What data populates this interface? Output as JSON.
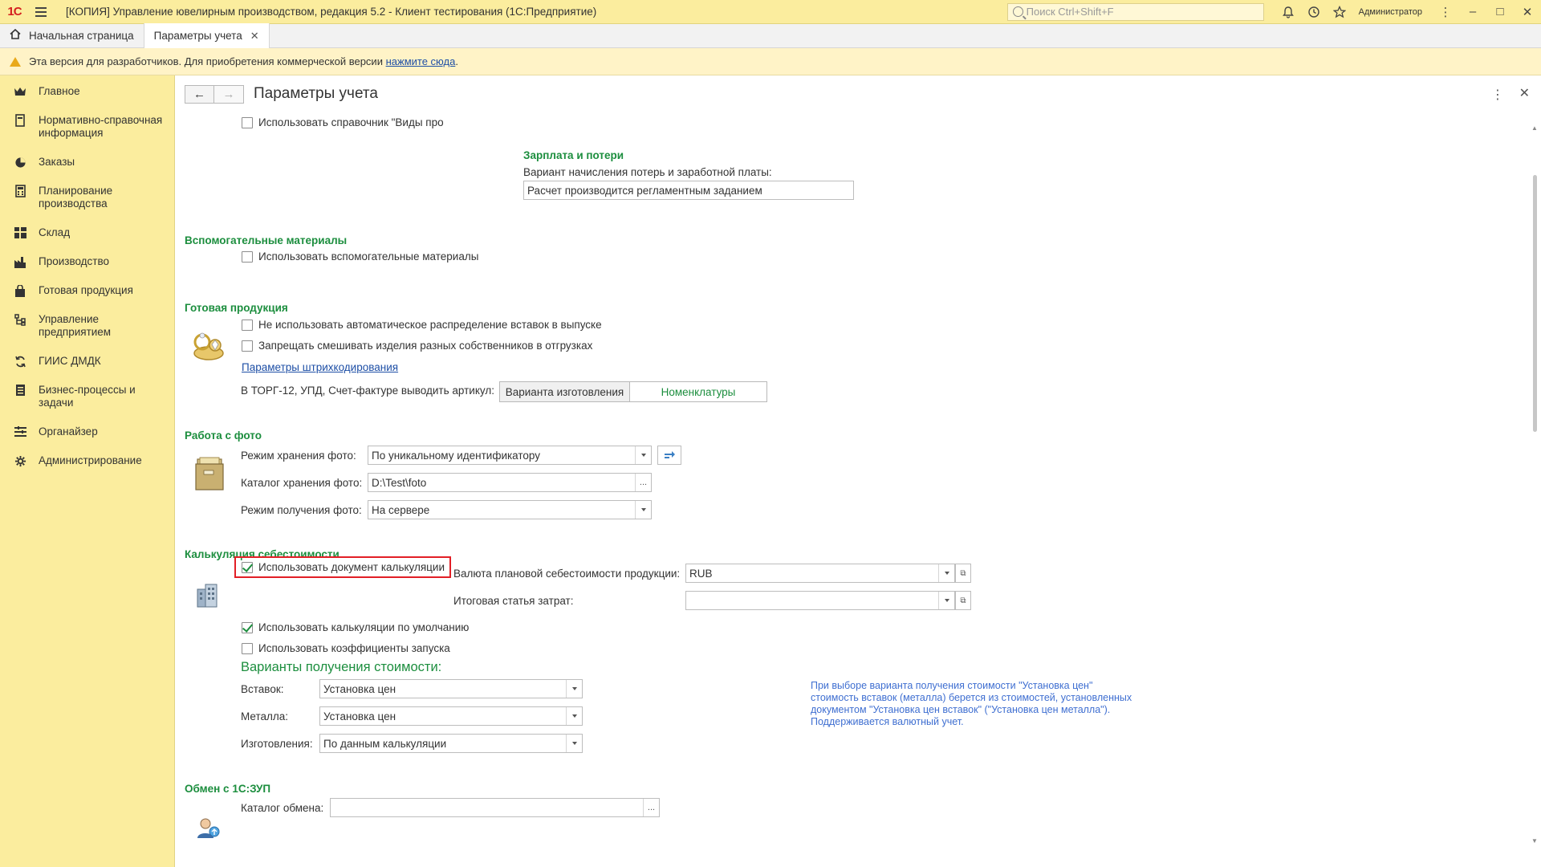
{
  "titlebar": {
    "logo": "1С",
    "title": "[КОПИЯ] Управление ювелирным производством, редакция 5.2  - Клиент тестирования (1С:Предприятие)",
    "search_placeholder": "Поиск Ctrl+Shift+F",
    "user": "Администратор",
    "icons": [
      "bell-icon",
      "history-icon",
      "star-icon",
      "user-icon",
      "menu-dots-icon",
      "minimize-icon",
      "maximize-icon",
      "close-icon"
    ]
  },
  "tabs": [
    {
      "label": "Начальная страница",
      "icon": "home-icon"
    },
    {
      "label": "Параметры учета",
      "closable": true
    }
  ],
  "notice": {
    "text": "Эта версия для разработчиков. Для приобретения коммерческой версии ",
    "link": "нажмите сюда",
    "tail": "."
  },
  "sidebar": {
    "items": [
      {
        "label": "Главное",
        "icon": "crown-icon"
      },
      {
        "label": "Нормативно-справочная информация",
        "icon": "book-icon"
      },
      {
        "label": "Заказы",
        "icon": "pie-icon"
      },
      {
        "label": "Планирование производства",
        "icon": "calc-icon"
      },
      {
        "label": "Склад",
        "icon": "grid-icon"
      },
      {
        "label": "Производство",
        "icon": "factory-icon"
      },
      {
        "label": "Готовая продукция",
        "icon": "bag-icon"
      },
      {
        "label": "Управление предприятием",
        "icon": "org-icon"
      },
      {
        "label": "ГИИС ДМДК",
        "icon": "sync-icon"
      },
      {
        "label": "Бизнес-процессы и задачи",
        "icon": "tasks-icon"
      },
      {
        "label": "Органайзер",
        "icon": "organizer-icon"
      },
      {
        "label": "Администрирование",
        "icon": "gear-icon"
      }
    ]
  },
  "form": {
    "title": "Параметры учета",
    "top_checkbox": "Использовать справочник \"Виды про",
    "salary": {
      "title": "Зарплата и потери",
      "label": "Вариант начисления потерь и заработной платы:",
      "value": "Расчет производится регламентным заданием"
    },
    "aux": {
      "title": "Вспомогательные материалы",
      "checkbox": "Использовать вспомогательные материалы"
    },
    "finished": {
      "title": "Готовая продукция",
      "cb1": "Не использовать автоматическое распределение вставок в выпуске",
      "cb2": "Запрещать смешивать изделия разных собственников в отгрузках",
      "link": "Параметры штрихкодирования",
      "article_label": "В ТОРГ-12, УПД, Счет-фактуре выводить артикул:",
      "opt_a": "Варианта изготовления",
      "opt_b": "Номенклатуры",
      "selected": "Номенклатуры"
    },
    "photo": {
      "title": "Работа с фото",
      "mode_label": "Режим хранения фото:",
      "mode_value": "По уникальному идентификатору",
      "catalog_label": "Каталог хранения фото:",
      "catalog_value": "D:\\Test\\foto",
      "get_label": "Режим получения фото:",
      "get_value": "На сервере"
    },
    "costing": {
      "title": "Калькуляция себестоимости",
      "cb_use_doc": "Использовать документ калькуляции",
      "cb_use_doc_checked": true,
      "currency_label": "Валюта плановой себестоимости продукции:",
      "currency_value": "RUB",
      "cost_item_label": "Итоговая статья затрат:",
      "cost_item_value": "",
      "cb_default": "Использовать калькуляции по умолчанию",
      "cb_default_checked": true,
      "cb_coef": "Использовать коэффициенты запуска",
      "cb_coef_checked": false,
      "variants_title": "Варианты получения стоимости:",
      "inserts_label": "Вставок:",
      "inserts_value": "Установка цен",
      "metal_label": "Металла:",
      "metal_value": "Установка цен",
      "make_label": "Изготовления:",
      "make_value": "По данным калькуляции",
      "hint": "При выборе варианта получения стоимости \"Установка цен\" стоимость вставок (металла) берется из стоимостей, установленных документом \"Установка цен вставок\" (\"Установка цен металла\"). Поддерживается валютный учет."
    },
    "exchange": {
      "title": "Обмен с 1С:ЗУП",
      "catalog_label": "Каталог обмена:",
      "catalog_value": ""
    }
  },
  "colors": {
    "panel": "#fbed9e",
    "section_green": "#1c8e3e",
    "link_blue": "#1e4fa6",
    "highlight_red": "#e21f26"
  }
}
